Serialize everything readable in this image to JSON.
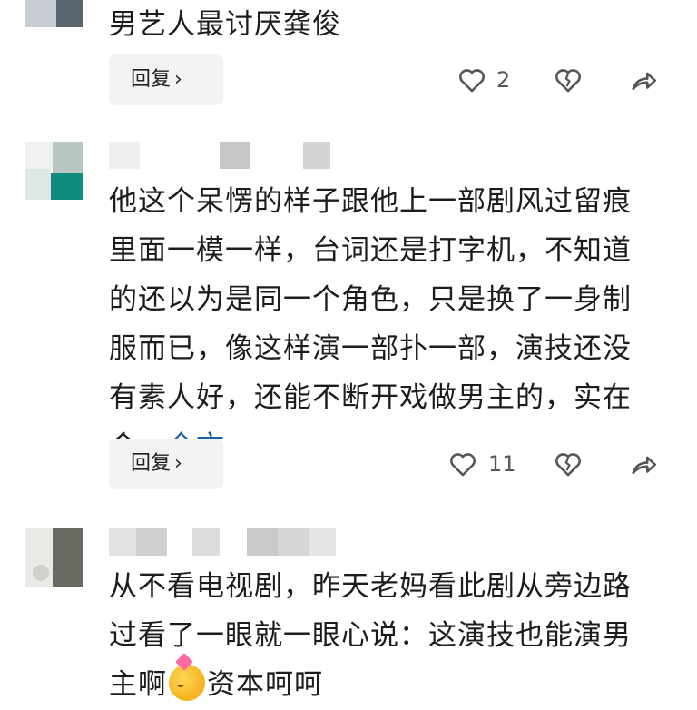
{
  "comments": [
    {
      "text": "男艺人最讨厌龚俊",
      "reply_label": "回复",
      "reply_chevron": "›",
      "like_count": "2",
      "icons": [
        "heart-icon",
        "broken-heart-icon",
        "share-icon"
      ]
    },
    {
      "text": "他这个呆愣的样子跟他上一部剧风过留痕里面一模一样，台词还是打字机，不知道的还以为是同一个角色，只是换了一身制服而已，像这样演一部扑一部，演技还没有素人好，还能不断开戏做男主的，实在令…",
      "more_label": "全文",
      "reply_label": "回复",
      "reply_chevron": "›",
      "like_count": "11",
      "icons": [
        "heart-icon",
        "broken-heart-icon",
        "share-icon"
      ]
    },
    {
      "text_before_emoji": "从不看电视剧，昨天老妈看此剧从旁边路过看了一眼就一眼心说：这演技也能演男主啊",
      "emoji": "party-face-emoji",
      "text_after_emoji": "资本呵呵"
    }
  ],
  "colors": {
    "link": "#1c5fa8",
    "reply_bg": "#f3f3f3",
    "text": "#1c1c1c",
    "icon": "#555555"
  }
}
